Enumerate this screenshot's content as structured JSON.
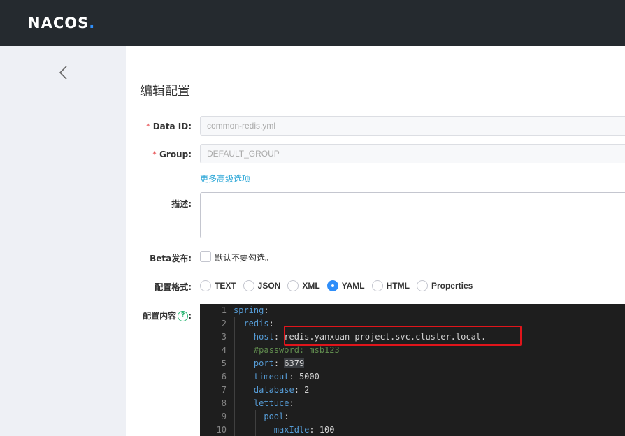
{
  "header": {
    "logo_text": "NACOS",
    "logo_dot": "."
  },
  "page": {
    "title": "编辑配置"
  },
  "form": {
    "data_id": {
      "required_mark": "*",
      "label": "Data ID:",
      "value": "common-redis.yml"
    },
    "group": {
      "required_mark": "*",
      "label": "Group:",
      "value": "DEFAULT_GROUP"
    },
    "advanced_link": "更多高级选项",
    "description": {
      "label": "描述:"
    },
    "beta": {
      "label": "Beta发布:",
      "checkbox_text": "默认不要勾选。"
    },
    "format": {
      "label": "配置格式:",
      "options": [
        "TEXT",
        "JSON",
        "XML",
        "YAML",
        "HTML",
        "Properties"
      ],
      "selected": "YAML"
    },
    "content": {
      "label": "配置内容",
      "help": "?",
      "colon": ":"
    }
  },
  "editor": {
    "line_numbers": [
      "1",
      "2",
      "3",
      "4",
      "5",
      "6",
      "7",
      "8",
      "9",
      "10"
    ],
    "lines": {
      "l1_key": "spring",
      "l1_colon": ":",
      "l2_key": "redis",
      "l2_colon": ":",
      "l3_key": "host",
      "l3_colon": ": ",
      "l3_val": "redis.yanxuan-project.svc.cluster.local.",
      "l4_comment": "#password: msb123",
      "l5_key": "port",
      "l5_colon": ": ",
      "l5_val": "6379",
      "l6_key": "timeout",
      "l6_colon": ": ",
      "l6_val": "5000",
      "l7_key": "database",
      "l7_colon": ": ",
      "l7_val": "2",
      "l8_key": "lettuce",
      "l8_colon": ":",
      "l9_key": "pool",
      "l9_colon": ":",
      "l10_key": "maxIdle",
      "l10_colon": ": ",
      "l10_val": "100"
    }
  },
  "colors": {
    "topbar": "#252a2f",
    "accent": "#2f8ef9",
    "highlight_box": "#e0151b",
    "editor_bg": "#1e1e1e"
  }
}
